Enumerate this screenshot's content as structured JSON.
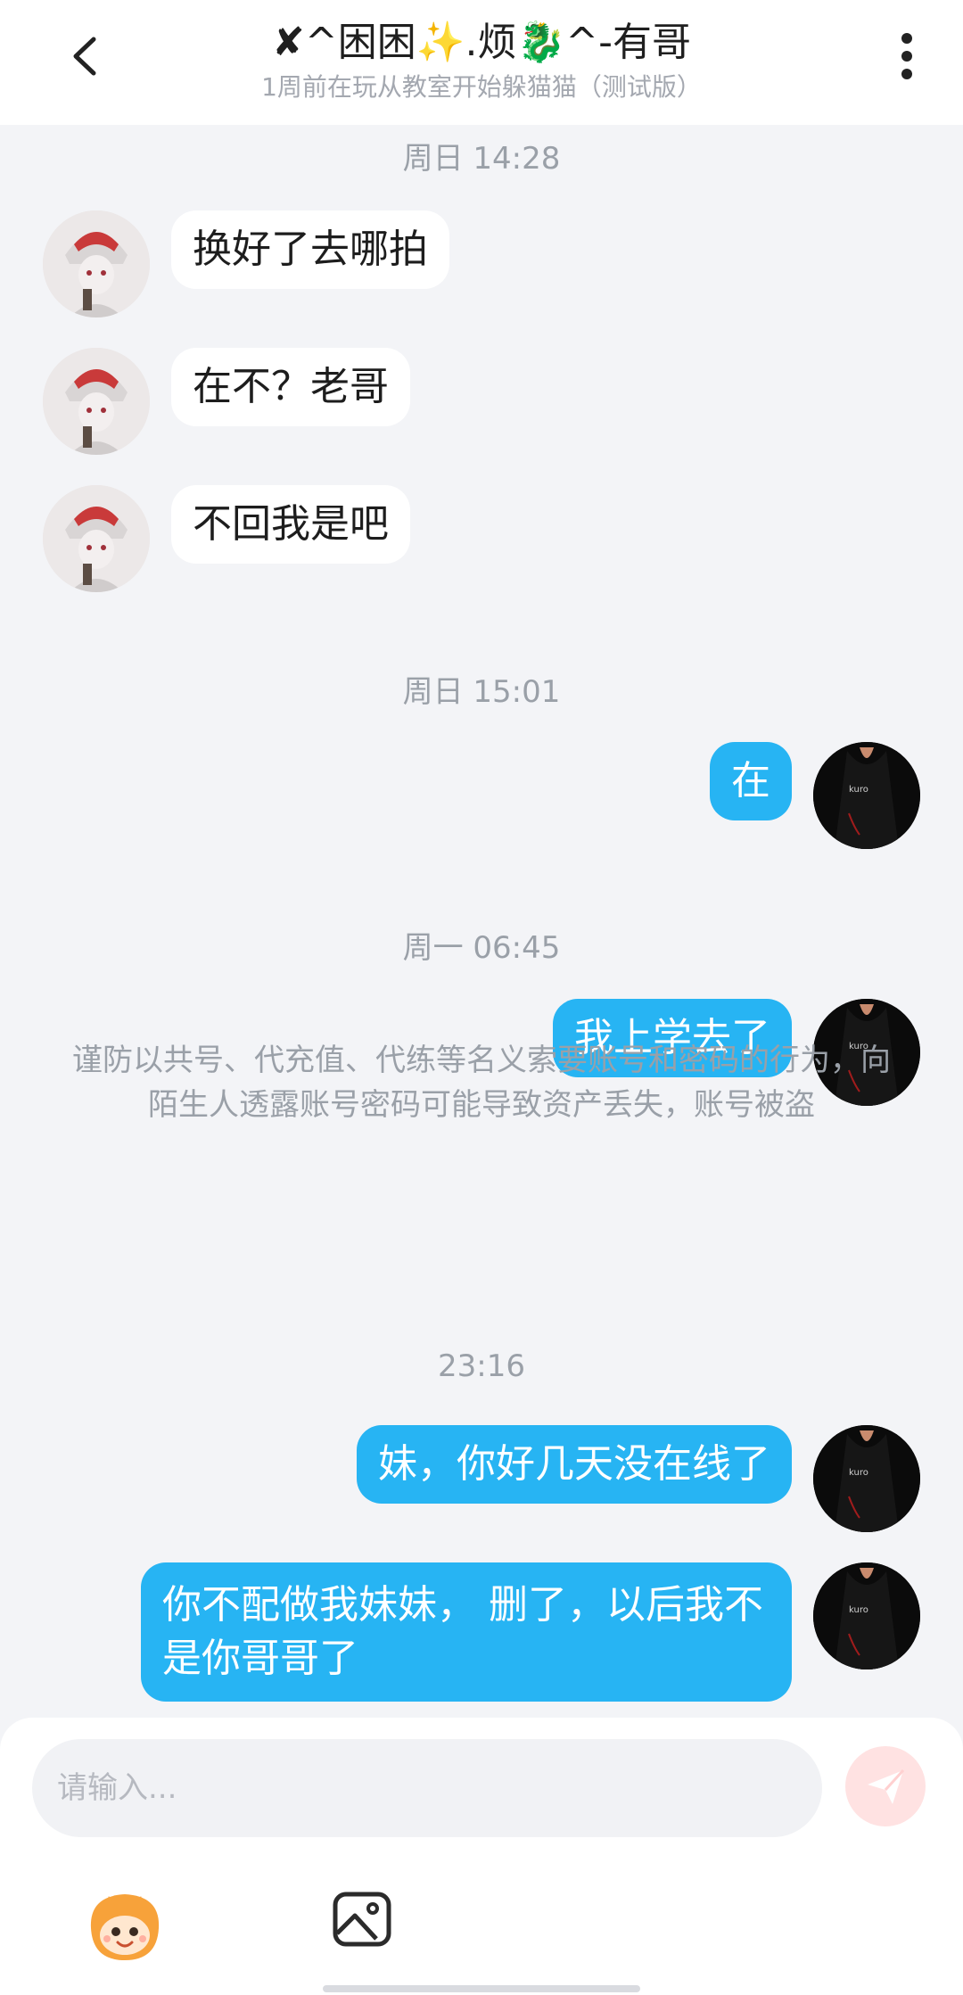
{
  "header": {
    "title": "✘^困困✨.烦🐉^-有哥",
    "subtitle": "1周前在玩从教室开始躲猫猫（测试版）"
  },
  "chat": {
    "timestamps": [
      "周日 14:28",
      "周日 15:01",
      "周一 06:45",
      "23:16"
    ],
    "incoming": [
      "换好了去哪拍",
      "在不？老哥",
      "不回我是吧"
    ],
    "outgoing": [
      "在",
      "我上学去了",
      "妹，你好几天没在线了",
      "你不配做我妹妹， 删了，以后我不是你哥哥了"
    ],
    "notice": "谨防以共号、代充值、代练等名义索要账号和密码的行为，向陌生人透露账号密码可能导致资产丢失，账号被盗"
  },
  "composer": {
    "placeholder": "请输入...",
    "icons": {
      "back": "chevron-left-icon",
      "more": "more-vertical-icon",
      "send": "send-icon",
      "emoji": "emoji-icon",
      "image": "image-icon"
    }
  },
  "colors": {
    "outgoing_bubble": "#27b4f3",
    "incoming_bubble": "#ffffff",
    "background": "#f3f4f7",
    "send_button": "#ffe2e2"
  }
}
